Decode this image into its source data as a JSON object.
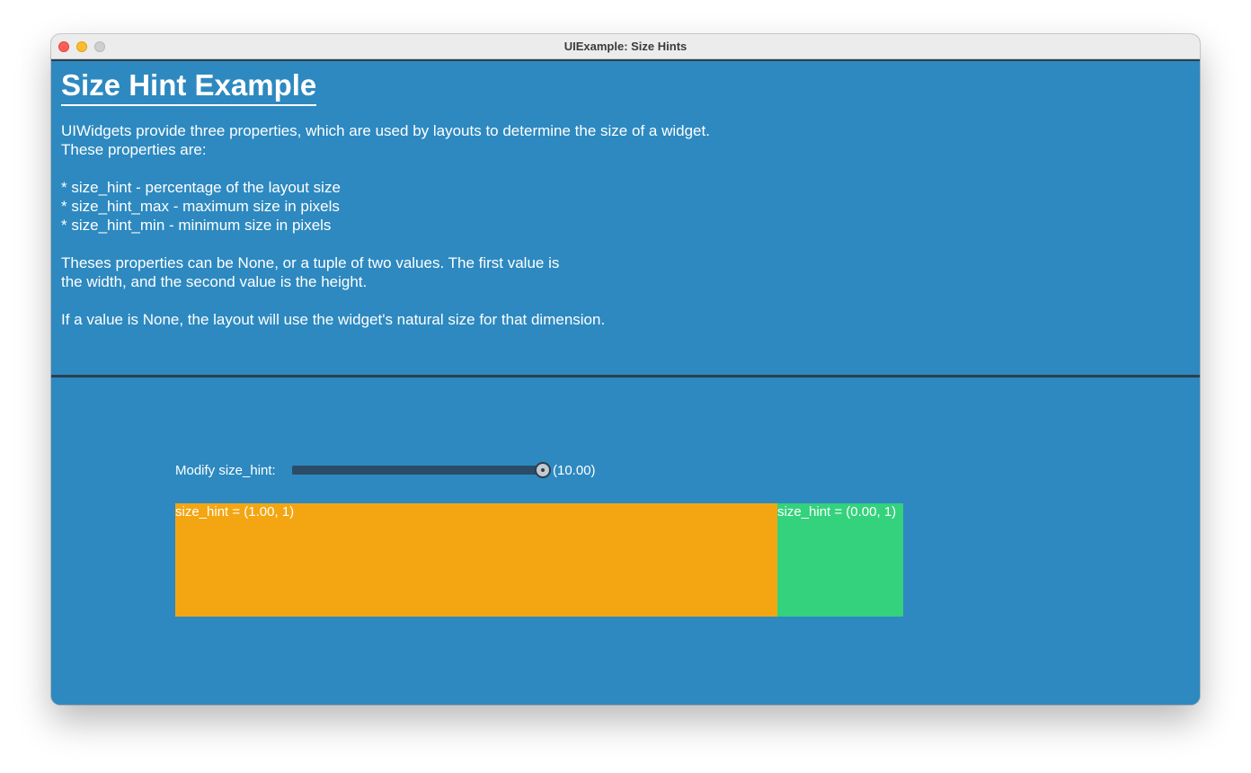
{
  "window": {
    "title": "UIExample: Size Hints"
  },
  "header": {
    "title": "Size Hint Example",
    "lines": [
      "UIWidgets provide three properties, which are used by layouts to determine the size of a widget.",
      "These properties are:",
      "",
      "* size_hint - percentage of the layout size",
      "* size_hint_max - maximum size in pixels",
      "* size_hint_min - minimum size in pixels",
      "",
      "Theses properties can be None, or a tuple of two values. The first value is",
      "the width, and the second value is the height.",
      "",
      "If a value is None, the layout will use the widget's natural size for that dimension."
    ]
  },
  "controls": {
    "slider_label": "Modify size_hint:",
    "slider_value_text": "(10.00)",
    "slider_fraction": 1.0
  },
  "boxes": {
    "left_label": "size_hint = (1.00, 1)",
    "right_label": "size_hint = (0.00, 1)"
  },
  "colors": {
    "background": "#2d89c0",
    "divider": "#2b3e50",
    "left_box": "#f3a612",
    "right_box": "#34d27c"
  }
}
